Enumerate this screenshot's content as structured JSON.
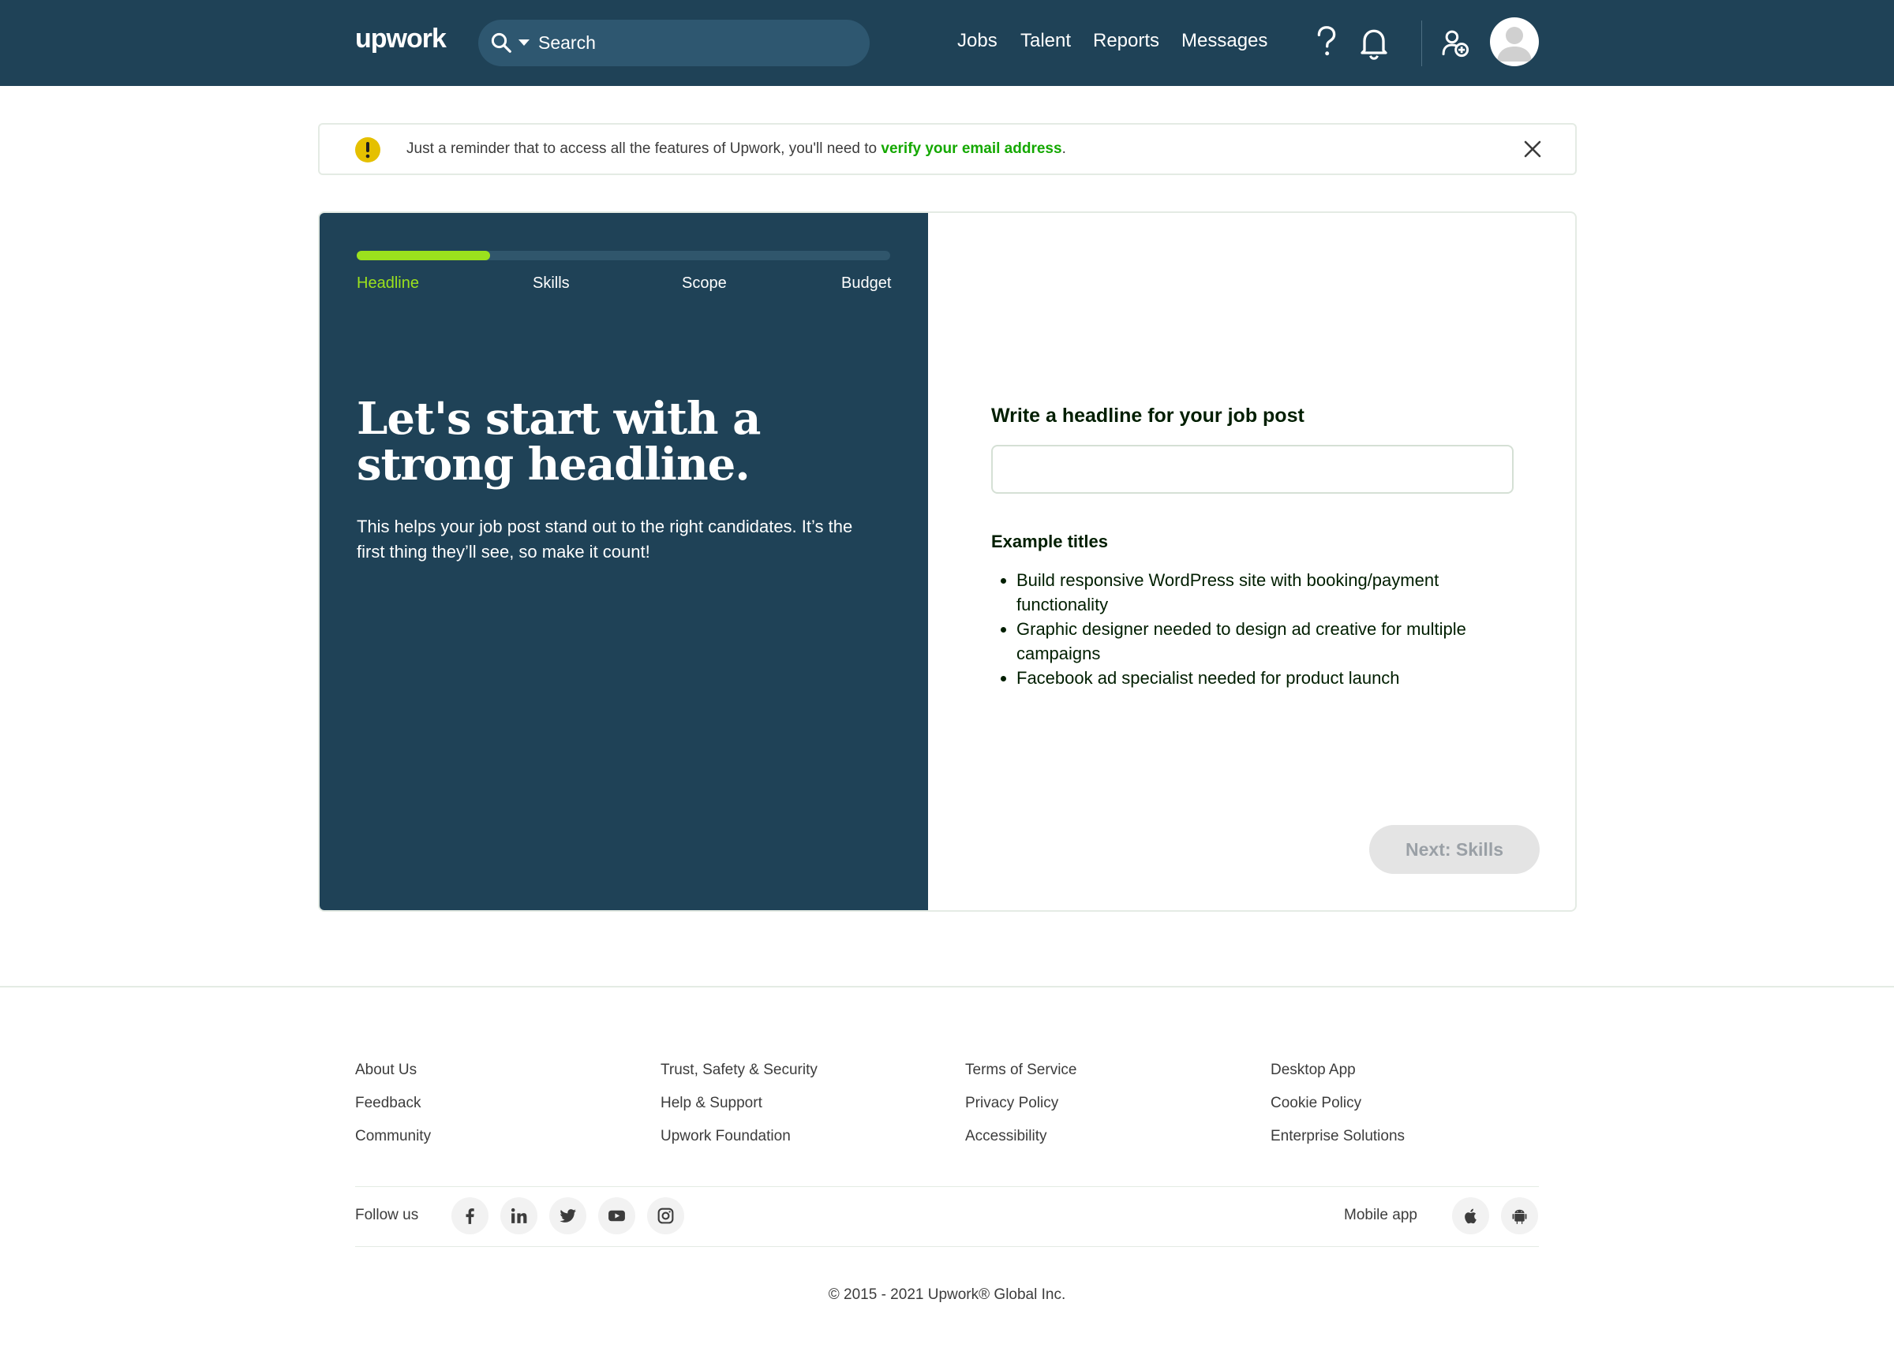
{
  "header": {
    "logo": "upwork",
    "search_placeholder": "Search",
    "nav": [
      "Jobs",
      "Talent",
      "Reports",
      "Messages"
    ],
    "icons": [
      "help-icon",
      "bell-icon",
      "add-user-icon",
      "avatar"
    ]
  },
  "banner": {
    "text": "Just a reminder that to access all the features of Upwork, you'll need to ",
    "link": "verify your email address",
    "suffix": "."
  },
  "wizard": {
    "progress": 0.25,
    "steps": [
      "Headline",
      "Skills",
      "Scope",
      "Budget"
    ],
    "active_step": "Headline",
    "title": "Let's start with a strong headline.",
    "subtitle": "This helps your job post stand out to the right candidates. It’s the first thing they’ll see, so make it count!",
    "form_label": "Write a headline for your job post",
    "input_value": "",
    "examples_title": "Example titles",
    "examples": [
      "Build responsive WordPress site with booking/payment functionality",
      "Graphic designer needed to design ad creative for multiple campaigns",
      "Facebook ad specialist needed for product launch"
    ],
    "next_label": "Next: Skills"
  },
  "footer": {
    "columns": [
      [
        "About Us",
        "Feedback",
        "Community"
      ],
      [
        "Trust, Safety & Security",
        "Help & Support",
        "Upwork Foundation"
      ],
      [
        "Terms of Service",
        "Privacy Policy",
        "Accessibility"
      ],
      [
        "Desktop App",
        "Cookie Policy",
        "Enterprise Solutions"
      ]
    ],
    "follow_label": "Follow us",
    "social": [
      "facebook-icon",
      "linkedin-icon",
      "twitter-icon",
      "youtube-icon",
      "instagram-icon"
    ],
    "mobile_label": "Mobile app",
    "mobile": [
      "apple-icon",
      "android-icon"
    ],
    "copyright": "© 2015 - 2021 Upwork® Global Inc."
  },
  "colors": {
    "header_bg": "#1f4257",
    "accent_green": "#9be11d",
    "link_green": "#14a800",
    "warning": "#e5c000"
  }
}
